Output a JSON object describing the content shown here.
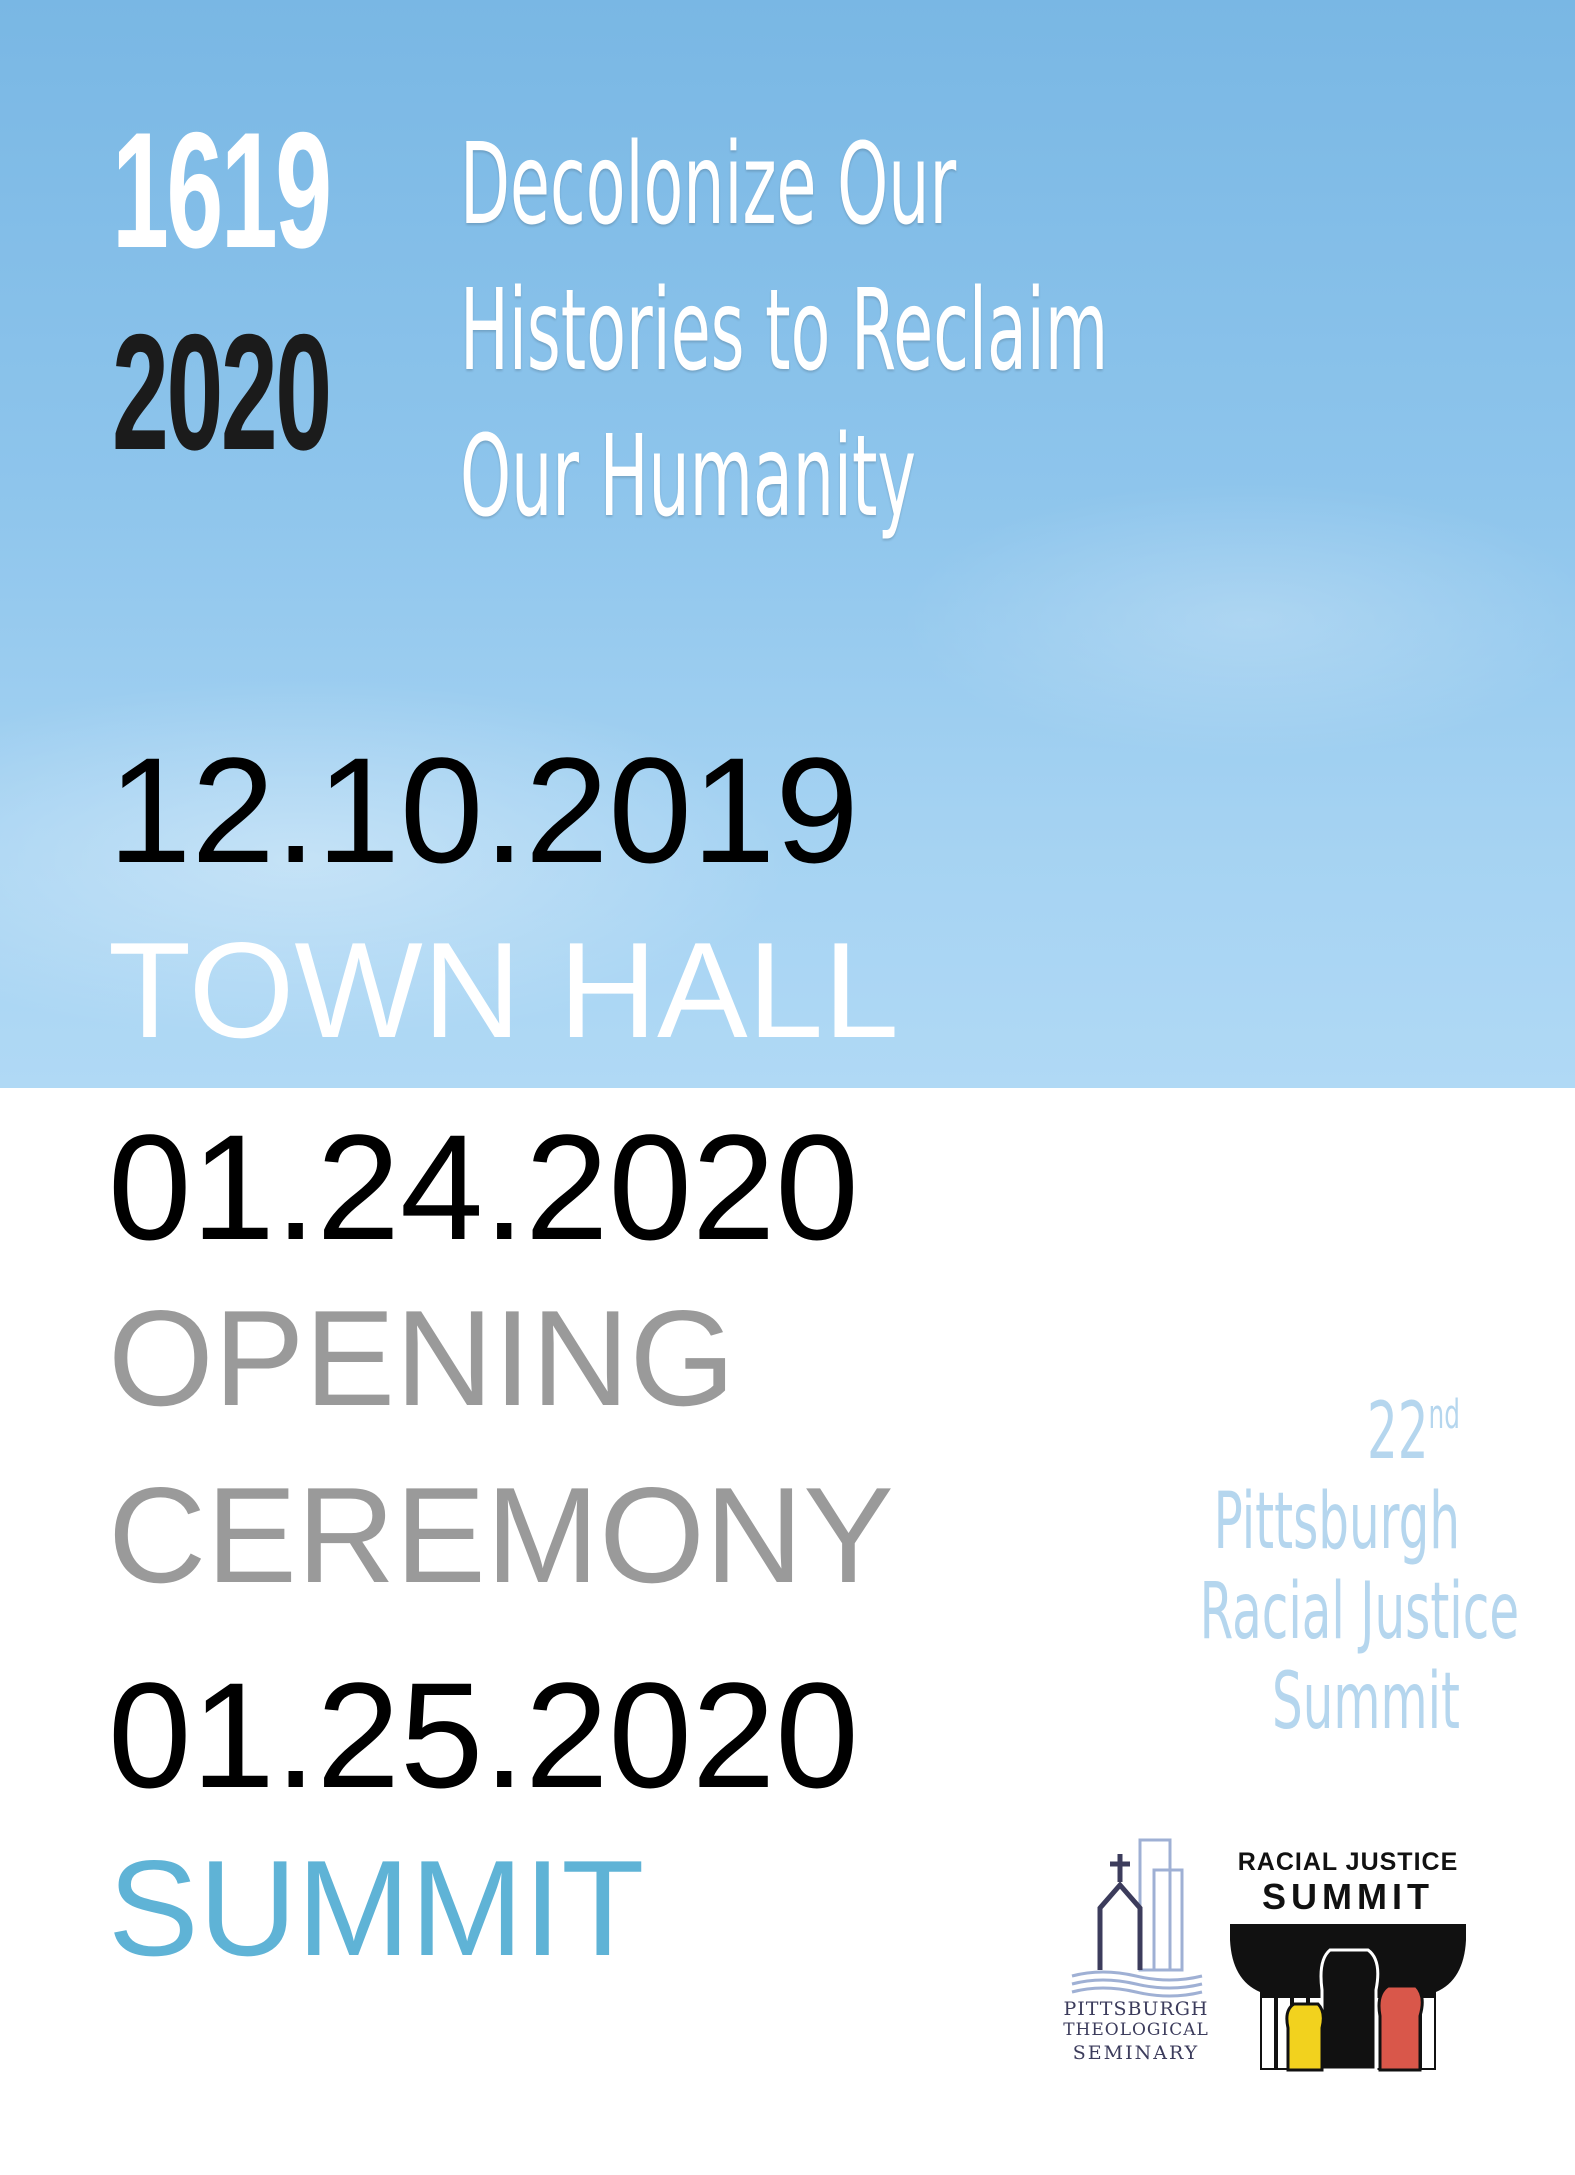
{
  "header": {
    "year_top": "1619",
    "year_bottom": "2020",
    "tagline": [
      "Decolonize Our",
      "Histories to Reclaim",
      "Our Humanity"
    ]
  },
  "events": [
    {
      "date": "12.10.2019",
      "name": [
        "TOWN HALL"
      ]
    },
    {
      "date": "01.24.2020",
      "name": [
        "OPENING",
        "CEREMONY"
      ]
    },
    {
      "date": "01.25.2020",
      "name": [
        "SUMMIT"
      ]
    }
  ],
  "summit_title": {
    "ordinal": "22",
    "ordinal_suffix": "nd",
    "lines": [
      "Pittsburgh",
      "Racial Justice",
      "Summit"
    ]
  },
  "logos": {
    "seminary": [
      "PITTSBURGH",
      "THEOLOGICAL",
      "SEMINARY"
    ],
    "summit_logo_top": "RACIAL JUSTICE",
    "summit_logo_main": "SUMMIT"
  },
  "colors": {
    "sky": "#8ec5ec",
    "event1": "#ffffff",
    "event2": "#9a9a9a",
    "event3": "#5fb3d6",
    "summit_title": "#b5d6ee"
  }
}
